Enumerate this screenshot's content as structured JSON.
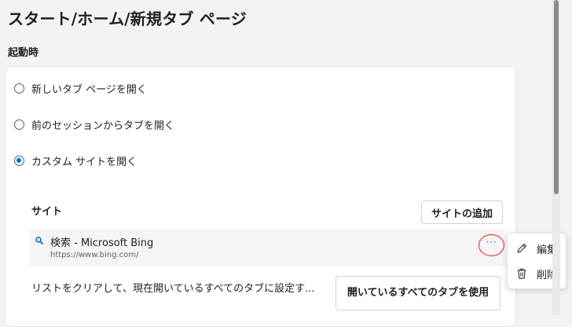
{
  "header": {
    "title": "スタート/ホーム/新規タブ ページ"
  },
  "startup": {
    "section_title": "起動時",
    "options": [
      {
        "label": "新しいタブ ページを開く",
        "selected": false
      },
      {
        "label": "前のセッションからタブを開く",
        "selected": false
      },
      {
        "label": "カスタム サイトを開く",
        "selected": true
      }
    ]
  },
  "sites": {
    "heading": "サイト",
    "add_button": "サイトの追加",
    "items": [
      {
        "title": "検索 - Microsoft Bing",
        "url": "https://www.bing.com/"
      }
    ],
    "more_button": "···"
  },
  "context_menu": {
    "items": [
      {
        "label": "編集",
        "icon": "pencil-icon"
      },
      {
        "label": "削除",
        "icon": "trash-icon"
      }
    ]
  },
  "clear_list": {
    "text": "リストをクリアして、現在開いているすべてのタブに設定す...",
    "button": "開いているすべてのタブを使用"
  },
  "colors": {
    "accent": "#0f6cbd",
    "highlight": "#e41e1e"
  }
}
